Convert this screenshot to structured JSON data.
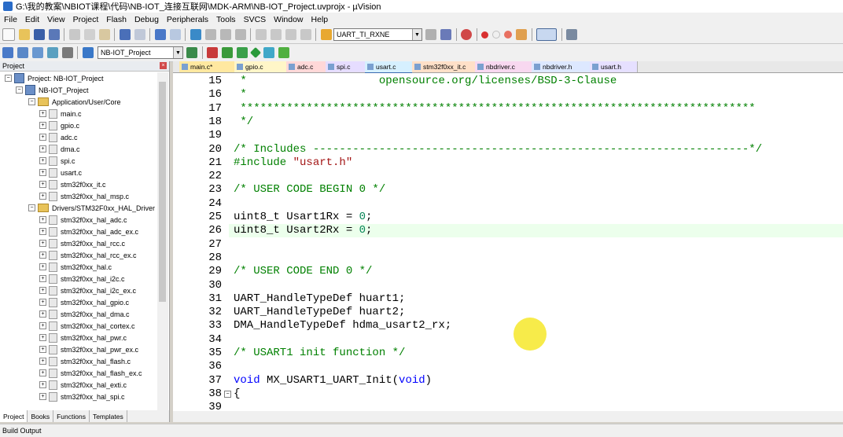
{
  "window": {
    "title": "G:\\我的教案\\NBIOT课程\\代码\\NB-IOT_连接互联网\\MDK-ARM\\NB-IOT_Project.uvprojx - µVision"
  },
  "menu": [
    "File",
    "Edit",
    "View",
    "Project",
    "Flash",
    "Debug",
    "Peripherals",
    "Tools",
    "SVCS",
    "Window",
    "Help"
  ],
  "toolbar": {
    "find_combo": "UART_TI_RXNE",
    "target_combo": "NB-IOT_Project"
  },
  "project_panel": {
    "title": "Project",
    "tree": [
      {
        "label": "Project: NB-IOT_Project",
        "level": 0,
        "kind": "project"
      },
      {
        "label": "NB-IOT_Project",
        "level": 1,
        "kind": "target"
      },
      {
        "label": "Application/User/Core",
        "level": 2,
        "kind": "folder"
      },
      {
        "label": "main.c",
        "level": 3,
        "kind": "file"
      },
      {
        "label": "gpio.c",
        "level": 3,
        "kind": "file"
      },
      {
        "label": "adc.c",
        "level": 3,
        "kind": "file"
      },
      {
        "label": "dma.c",
        "level": 3,
        "kind": "file"
      },
      {
        "label": "spi.c",
        "level": 3,
        "kind": "file"
      },
      {
        "label": "usart.c",
        "level": 3,
        "kind": "file"
      },
      {
        "label": "stm32f0xx_it.c",
        "level": 3,
        "kind": "file"
      },
      {
        "label": "stm32f0xx_hal_msp.c",
        "level": 3,
        "kind": "file"
      },
      {
        "label": "Drivers/STM32F0xx_HAL_Driver",
        "level": 2,
        "kind": "folder"
      },
      {
        "label": "stm32f0xx_hal_adc.c",
        "level": 3,
        "kind": "file"
      },
      {
        "label": "stm32f0xx_hal_adc_ex.c",
        "level": 3,
        "kind": "file"
      },
      {
        "label": "stm32f0xx_hal_rcc.c",
        "level": 3,
        "kind": "file"
      },
      {
        "label": "stm32f0xx_hal_rcc_ex.c",
        "level": 3,
        "kind": "file"
      },
      {
        "label": "stm32f0xx_hal.c",
        "level": 3,
        "kind": "file"
      },
      {
        "label": "stm32f0xx_hal_i2c.c",
        "level": 3,
        "kind": "file"
      },
      {
        "label": "stm32f0xx_hal_i2c_ex.c",
        "level": 3,
        "kind": "file"
      },
      {
        "label": "stm32f0xx_hal_gpio.c",
        "level": 3,
        "kind": "file"
      },
      {
        "label": "stm32f0xx_hal_dma.c",
        "level": 3,
        "kind": "file"
      },
      {
        "label": "stm32f0xx_hal_cortex.c",
        "level": 3,
        "kind": "file"
      },
      {
        "label": "stm32f0xx_hal_pwr.c",
        "level": 3,
        "kind": "file"
      },
      {
        "label": "stm32f0xx_hal_pwr_ex.c",
        "level": 3,
        "kind": "file"
      },
      {
        "label": "stm32f0xx_hal_flash.c",
        "level": 3,
        "kind": "file"
      },
      {
        "label": "stm32f0xx_hal_flash_ex.c",
        "level": 3,
        "kind": "file"
      },
      {
        "label": "stm32f0xx_hal_exti.c",
        "level": 3,
        "kind": "file"
      },
      {
        "label": "stm32f0xx_hal_spi.c",
        "level": 3,
        "kind": "file"
      }
    ],
    "tabs": [
      "Project",
      "Books",
      "Functions",
      "Templates"
    ]
  },
  "editor_tabs": [
    {
      "label": "main.c*",
      "color": "#ffe8a0"
    },
    {
      "label": "gpio.c",
      "color": "#fff6c8"
    },
    {
      "label": "adc.c",
      "color": "#ffd8d8"
    },
    {
      "label": "spi.c",
      "color": "#e6ddff"
    },
    {
      "label": "usart.c",
      "color": "#d6f0ff",
      "active": true
    },
    {
      "label": "stm32f0xx_it.c",
      "color": "#ffe0c8"
    },
    {
      "label": "nbdriver.c",
      "color": "#f8d8f0"
    },
    {
      "label": "nbdriver.h",
      "color": "#dde8ff"
    },
    {
      "label": "usart.h",
      "color": "#e6e0ff"
    }
  ],
  "code_lines": [
    {
      "n": "15",
      "segs": [
        [
          "cm",
          " *                    opensource.org/licenses/BSD-3-Clause"
        ]
      ]
    },
    {
      "n": "16",
      "segs": [
        [
          "cm",
          " *"
        ]
      ]
    },
    {
      "n": "17",
      "segs": [
        [
          "cm",
          " ******************************************************************************"
        ]
      ]
    },
    {
      "n": "18",
      "segs": [
        [
          "cm",
          " */"
        ]
      ]
    },
    {
      "n": "19",
      "segs": []
    },
    {
      "n": "20",
      "segs": [
        [
          "cm",
          "/* Includes ------------------------------------------------------------------*/"
        ]
      ]
    },
    {
      "n": "21",
      "segs": [
        [
          "cm",
          "#include "
        ],
        [
          "str",
          "\"usart.h\""
        ]
      ]
    },
    {
      "n": "22",
      "segs": []
    },
    {
      "n": "23",
      "segs": [
        [
          "cm",
          "/* USER CODE BEGIN 0 */"
        ]
      ]
    },
    {
      "n": "24",
      "segs": []
    },
    {
      "n": "25",
      "segs": [
        [
          "pl",
          "uint8_t Usart1Rx = "
        ],
        [
          "num",
          "0"
        ],
        [
          "pl",
          ";"
        ]
      ]
    },
    {
      "n": "26",
      "segs": [
        [
          "pl",
          "uint8_t Usart2Rx = "
        ],
        [
          "num",
          "0"
        ],
        [
          "pl",
          ";"
        ]
      ]
    },
    {
      "n": "27",
      "segs": []
    },
    {
      "n": "28",
      "segs": []
    },
    {
      "n": "29",
      "segs": [
        [
          "cm",
          "/* USER CODE END 0 */"
        ]
      ]
    },
    {
      "n": "30",
      "segs": []
    },
    {
      "n": "31",
      "segs": [
        [
          "pl",
          "UART_HandleTypeDef huart1;"
        ]
      ]
    },
    {
      "n": "32",
      "segs": [
        [
          "pl",
          "UART_HandleTypeDef huart2;"
        ]
      ]
    },
    {
      "n": "33",
      "segs": [
        [
          "pl",
          "DMA_HandleTypeDef hdma_usart2_rx;"
        ]
      ]
    },
    {
      "n": "34",
      "segs": []
    },
    {
      "n": "35",
      "segs": [
        [
          "cm",
          "/* USART1 init function */"
        ]
      ]
    },
    {
      "n": "36",
      "segs": []
    },
    {
      "n": "37",
      "segs": [
        [
          "kw",
          "void"
        ],
        [
          "pl",
          " MX_USART1_UART_Init("
        ],
        [
          "kw",
          "void"
        ],
        [
          "pl",
          ")"
        ]
      ]
    },
    {
      "n": "38",
      "segs": [
        [
          "pl",
          "{"
        ]
      ]
    },
    {
      "n": "39",
      "segs": []
    }
  ],
  "status": {
    "build_output": "Build Output"
  }
}
